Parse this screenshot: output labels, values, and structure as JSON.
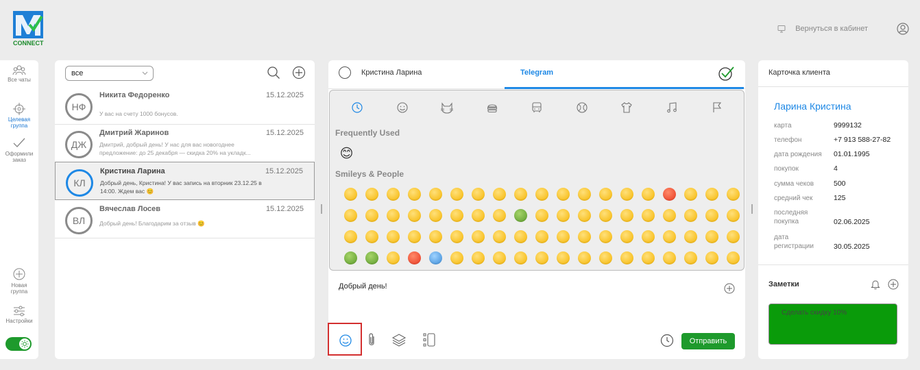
{
  "brand": {
    "logo_word": "CONNECT",
    "logo_letters": "CRM"
  },
  "header": {
    "back_label": "Вернуться в кабинет"
  },
  "rail": {
    "items": [
      {
        "label": "Все чаты"
      },
      {
        "label": "Целевая группа"
      },
      {
        "label": "Оформили заказ"
      },
      {
        "label": "Новая группа"
      },
      {
        "label": "Настройки"
      }
    ]
  },
  "chat_list": {
    "filter_value": "все",
    "chats": [
      {
        "initials": "НФ",
        "name": "Никита Федоренко",
        "date": "15.12.2025",
        "preview": "У вас на счету 1000 бонусов."
      },
      {
        "initials": "ДЖ",
        "name": "Дмитрий Жаринов",
        "date": "15.12.2025",
        "preview": "Дмитрий, добрый день! У нас для вас новогоднее предложение: до 25 декабря — скидка 20% на укладк..."
      },
      {
        "initials": "КЛ",
        "name": "Кристина Ларина",
        "date": "15.12.2025",
        "preview": "Добрый день, Кристина! У вас запись на вторник 23.12.25 в 14:00. Ждем вас 😊"
      },
      {
        "initials": "ВЛ",
        "name": "Вячеслав Лосев",
        "date": "15.12.2025",
        "preview": "Добрый день! Благодарим за отзыв 😊"
      }
    ]
  },
  "chat": {
    "contact_name": "Кристина Ларина",
    "channel": "Telegram",
    "emoji_picker": {
      "categories": [
        "recent-icon",
        "smiley-icon",
        "cat-icon",
        "burger-icon",
        "bus-icon",
        "ball-icon",
        "shirt-icon",
        "music-icon",
        "flag-icon"
      ],
      "frequently_used_label": "Frequently Used",
      "smileys_label": "Smileys & People",
      "frequent": [
        "😊"
      ]
    },
    "message_text": "Добрый день!",
    "send_label": "Отправить"
  },
  "client_card": {
    "title": "Карточка клиента",
    "name": "Ларина Кристина",
    "fields": [
      {
        "label": "карта",
        "value": "9999132"
      },
      {
        "label": "телефон",
        "value": "+7 913 588-27-82"
      },
      {
        "label": "дата рождения",
        "value": "01.01.1995"
      },
      {
        "label": "покупок",
        "value": "4"
      },
      {
        "label": "сумма чеков",
        "value": "500"
      },
      {
        "label": "средний чек",
        "value": "125"
      },
      {
        "label": "последняя покупка",
        "value": "02.06.2025"
      },
      {
        "label": "дата регистрации",
        "value": "30.05.2025"
      }
    ],
    "notes_title": "Заметки",
    "note_text": "Сделать скидку 10%"
  },
  "colors": {
    "accent": "#1e88e5",
    "brand_green": "#1e9a2c",
    "note_green": "#0a9b0a",
    "highlight_red": "#d32f2f"
  }
}
